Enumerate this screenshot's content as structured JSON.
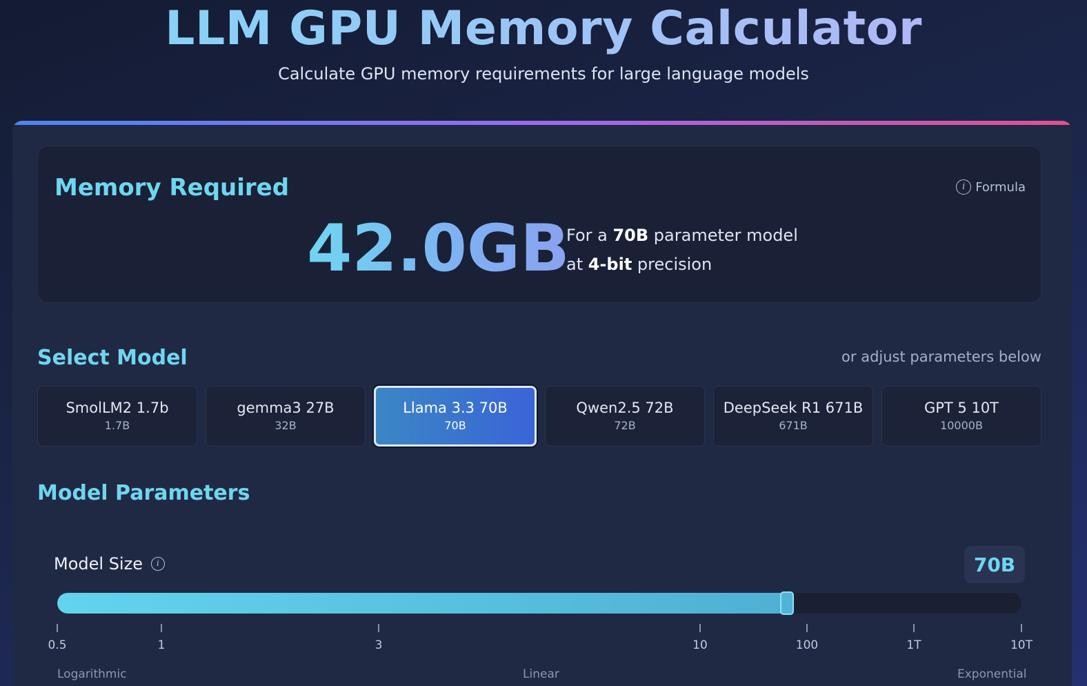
{
  "header": {
    "title": "LLM GPU Memory Calculator",
    "subtitle": "Calculate GPU memory requirements for large language models"
  },
  "memory": {
    "title": "Memory Required",
    "formula_label": "Formula",
    "value": "42.0GB",
    "desc_prefix_1": "For a ",
    "param_count": "70B",
    "desc_suffix_1": " parameter model",
    "desc_prefix_2": "at ",
    "precision": "4-bit",
    "desc_suffix_2": " precision"
  },
  "select_model": {
    "title": "Select Model",
    "hint": "or adjust parameters below",
    "models": [
      {
        "name": "SmolLM2 1.7b",
        "size": "1.7B",
        "active": false
      },
      {
        "name": "gemma3 27B",
        "size": "32B",
        "active": false
      },
      {
        "name": "Llama 3.3 70B",
        "size": "70B",
        "active": true
      },
      {
        "name": "Qwen2.5 72B",
        "size": "72B",
        "active": false
      },
      {
        "name": "DeepSeek R1 671B",
        "size": "671B",
        "active": false
      },
      {
        "name": "GPT 5 10T",
        "size": "10000B",
        "active": false
      }
    ]
  },
  "parameters": {
    "title": "Model Parameters",
    "model_size": {
      "label": "Model Size",
      "value": "70B",
      "slider_fraction": 0.757,
      "ticks": [
        "0.5",
        "1",
        "3",
        "10",
        "100",
        "1T",
        "10T"
      ],
      "scale_labels": [
        "Logarithmic",
        "Linear",
        "Exponential"
      ]
    }
  },
  "colors": {
    "accent": "#6fd6ee",
    "active_model": "#3a64d8"
  }
}
